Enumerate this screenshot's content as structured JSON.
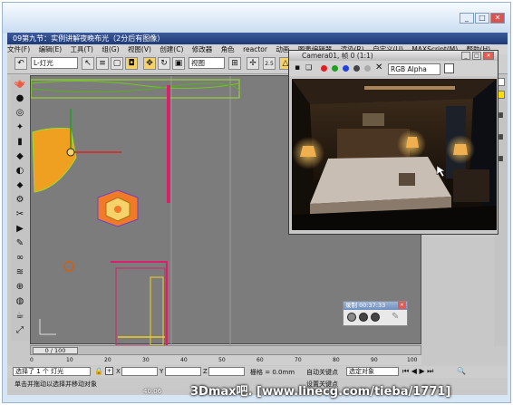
{
  "window": {
    "title": "09第九节：实例讲解夜晚布光（2分后有图像）",
    "minimize_label": "_",
    "maximize_label": "□",
    "close_label": "✕"
  },
  "menus": [
    "文件(F)",
    "编辑(E)",
    "工具(T)",
    "组(G)",
    "视图(V)",
    "创建(C)",
    "修改器",
    "角色",
    "reactor",
    "动画",
    "图表编辑器",
    "渲染(R)",
    "自定义(U)",
    "MAXScript(M)",
    "帮助(H)"
  ],
  "toolbar": {
    "selection_filter": "L-灯光",
    "coord_system": "视图",
    "snap_label": "2.5"
  },
  "render_window": {
    "title": "Camera01, 帧 0 (1:1)",
    "channel": "RGB Alpha"
  },
  "timeline": {
    "frame_readout": "0 / 100",
    "ticks": [
      "0",
      "10",
      "20",
      "30",
      "40",
      "50",
      "60",
      "70",
      "80",
      "90",
      "100"
    ]
  },
  "status": {
    "selected": "选择了 1 个 灯光",
    "x_label": "X",
    "y_label": "Y",
    "z_label": "Z",
    "grid": "栅格 = 0.0mm",
    "autokey": "自动关键点",
    "selected_objects": "选定对象",
    "set_key": "设置关键点",
    "prompt": "单击并拖动以选择并移动对象"
  },
  "recorder": {
    "title": "录制 00:37:33"
  },
  "caption": {
    "timestamp": "40:06",
    "watermark": "3Dmax吧. [www.linecg.com/tieba/1771]"
  },
  "colors": {
    "viewport": "#7c7c7c",
    "max_title": "#1f3a78",
    "light_orange": "#f0a020",
    "light_green": "#9adf2a",
    "wire_red": "#d8206b"
  }
}
